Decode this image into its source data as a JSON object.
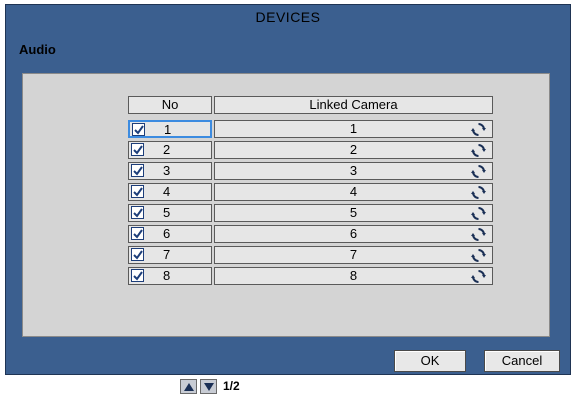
{
  "dialog": {
    "title": "DEVICES",
    "section_label": "Audio"
  },
  "table": {
    "columns": [
      "No",
      "Linked Camera"
    ],
    "rows": [
      {
        "no": "1",
        "checked": true,
        "linked_camera": "1",
        "selected": true
      },
      {
        "no": "2",
        "checked": true,
        "linked_camera": "2"
      },
      {
        "no": "3",
        "checked": true,
        "linked_camera": "3"
      },
      {
        "no": "4",
        "checked": true,
        "linked_camera": "4"
      },
      {
        "no": "5",
        "checked": true,
        "linked_camera": "5"
      },
      {
        "no": "6",
        "checked": true,
        "linked_camera": "6"
      },
      {
        "no": "7",
        "checked": true,
        "linked_camera": "7"
      },
      {
        "no": "8",
        "checked": true,
        "linked_camera": "8"
      }
    ]
  },
  "pagination": {
    "page_text": "1/2",
    "up_icon": "triangle-up-icon",
    "down_icon": "triangle-down-icon"
  },
  "buttons": {
    "ok_label": "OK",
    "cancel_label": "Cancel"
  },
  "colors": {
    "window_bg": "#3b5f8f",
    "panel_bg": "#d4d4d4",
    "selection": "#3c8be0",
    "checkbox": "#1d3e7a"
  }
}
